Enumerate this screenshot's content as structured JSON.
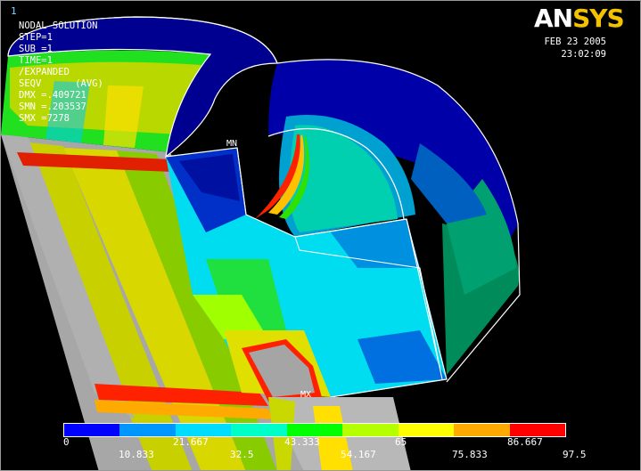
{
  "window": {
    "number": "1"
  },
  "info": {
    "lines": [
      "NODAL SOLUTION",
      "STEP=1",
      "SUB =1",
      "TIME=1",
      "/EXPANDED",
      "SEQV      (AVG)",
      "DMX =.409721",
      "SMN =.203537",
      "SMX =7278"
    ]
  },
  "logo": {
    "part1": "AN",
    "part2": "SYS"
  },
  "stamp": {
    "date": "FEB 23 2005",
    "time": "23:02:09"
  },
  "markers": {
    "min": "MN",
    "max": "MX"
  },
  "legend": {
    "colors": [
      "#0000ff",
      "#0096ff",
      "#00dcff",
      "#00ffc8",
      "#00ff00",
      "#b4ff00",
      "#ffff00",
      "#ffaa00",
      "#ff0000"
    ],
    "top_ticks": [
      "0",
      "21.667",
      "43.333",
      "65",
      "86.667"
    ],
    "bottom_ticks": [
      "10.833",
      "32.5",
      "54.167",
      "75.833",
      "97.5"
    ]
  },
  "palette": {
    "outer_ring": "#000080",
    "cyan_face": "#00e6ff",
    "grey": "#a0a0a0"
  }
}
